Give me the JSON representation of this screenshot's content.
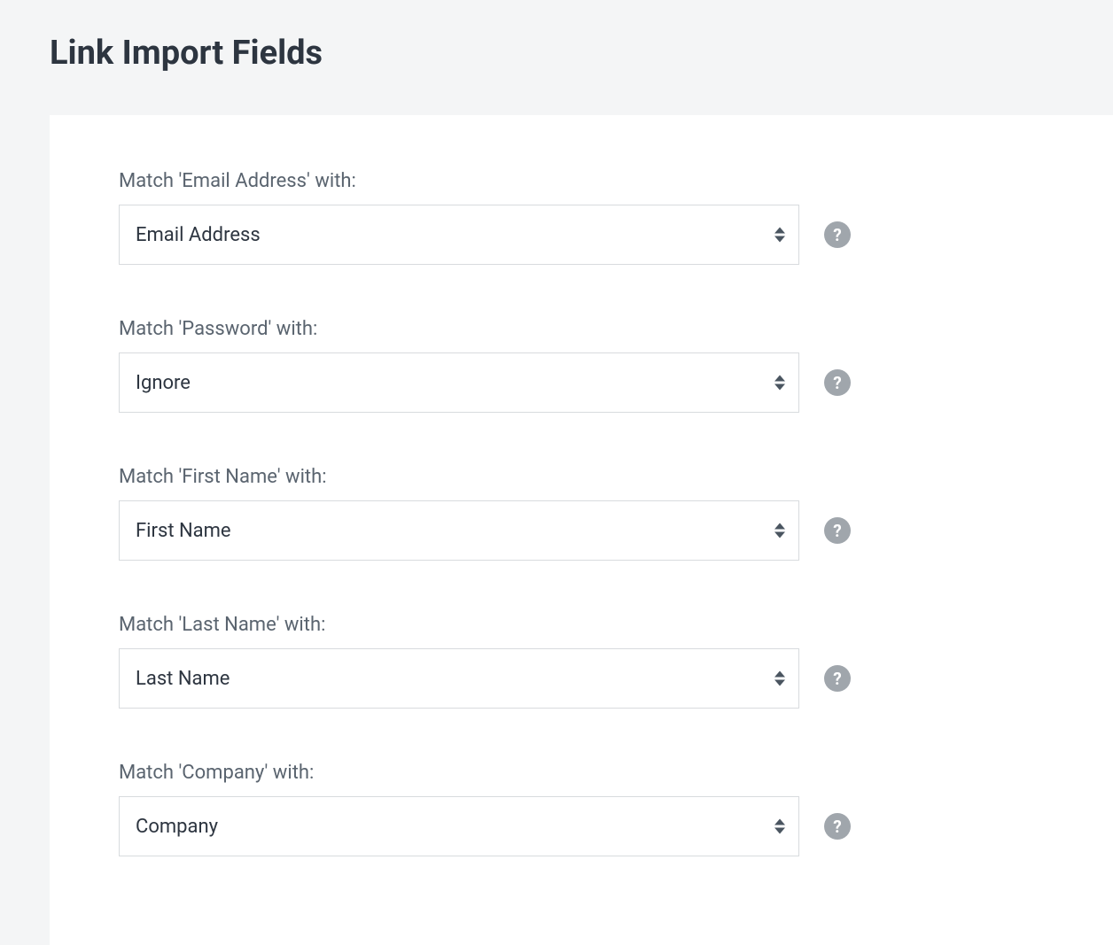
{
  "page": {
    "title": "Link Import Fields"
  },
  "fields": [
    {
      "label": "Match 'Email Address' with:",
      "selected": "Email Address"
    },
    {
      "label": "Match 'Password' with:",
      "selected": "Ignore"
    },
    {
      "label": "Match 'First Name' with:",
      "selected": "First Name"
    },
    {
      "label": "Match 'Last Name' with:",
      "selected": "Last Name"
    },
    {
      "label": "Match 'Company' with:",
      "selected": "Company"
    }
  ],
  "helpGlyph": "?"
}
